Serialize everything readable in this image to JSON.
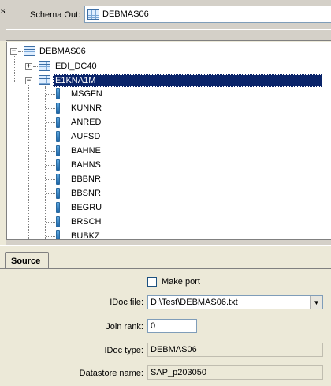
{
  "left_edge_char": "s",
  "schema_out": {
    "label": "Schema Out:",
    "value": "DEBMAS06"
  },
  "tree": {
    "root": "DEBMAS06",
    "children": [
      "EDI_DC40",
      "E1KNA1M"
    ],
    "fields": [
      "MSGFN",
      "KUNNR",
      "ANRED",
      "AUFSD",
      "BAHNE",
      "BAHNS",
      "BBBNR",
      "BBSNR",
      "BEGRU",
      "BRSCH",
      "BUBKZ"
    ]
  },
  "tabs": {
    "source": "Source"
  },
  "source": {
    "make_port_label": "Make port",
    "make_port_checked": false,
    "idoc_file_label": "IDoc file:",
    "idoc_file_value": "D:\\Test\\DEBMAS06.txt",
    "join_rank_label": "Join rank:",
    "join_rank_value": "0",
    "idoc_type_label": "IDoc type:",
    "idoc_type_value": "DEBMAS06",
    "datastore_label": "Datastore name:",
    "datastore_value": "SAP_p203050"
  }
}
